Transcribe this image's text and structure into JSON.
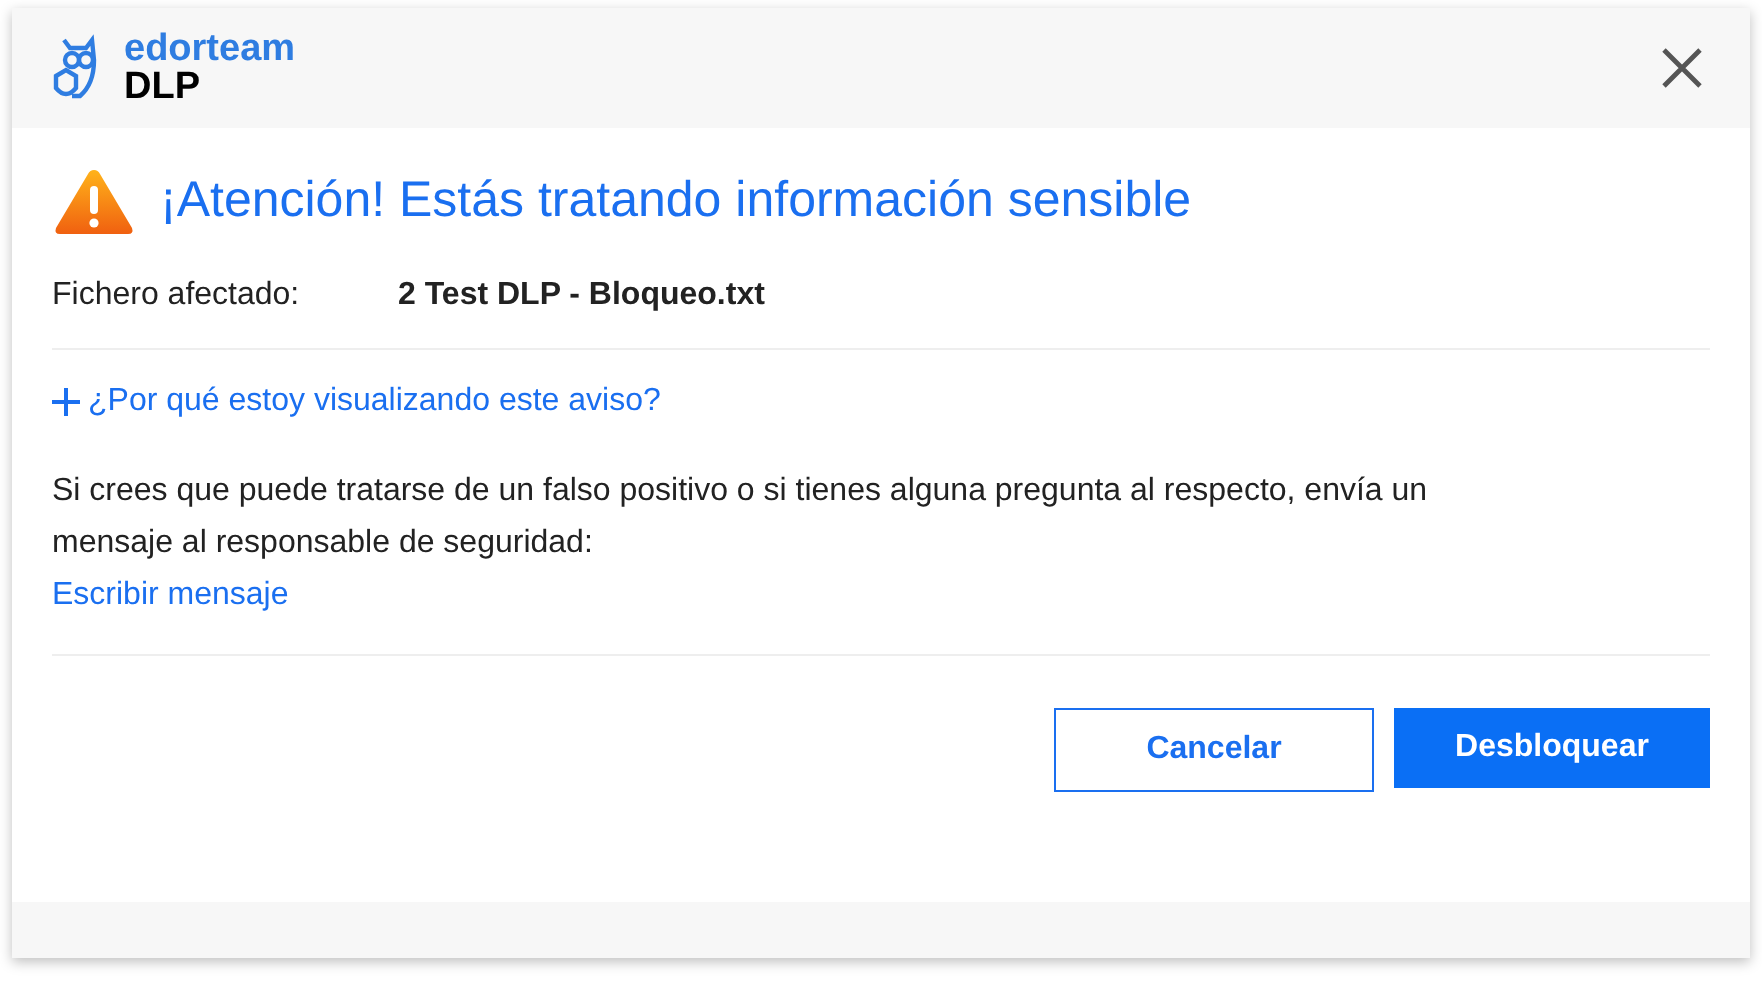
{
  "header": {
    "brand": "edorteam",
    "product": "DLP"
  },
  "alert": {
    "title": "¡Atención! Estás tratando información sensible"
  },
  "file": {
    "label": "Fichero afectado:",
    "value": "2 Test DLP - Bloqueo.txt"
  },
  "expander": {
    "label": "¿Por qué estoy visualizando este aviso?",
    "expanded": false
  },
  "message": "Si crees que puede tratarse de un falso positivo o si tienes alguna pregunta al respecto, envía un mensaje al responsable de seguridad:",
  "link": "Escribir mensaje",
  "buttons": [
    {
      "label": "Cancelar",
      "kind": "secondary"
    },
    {
      "label": "Desbloquear",
      "kind": "primary"
    }
  ]
}
